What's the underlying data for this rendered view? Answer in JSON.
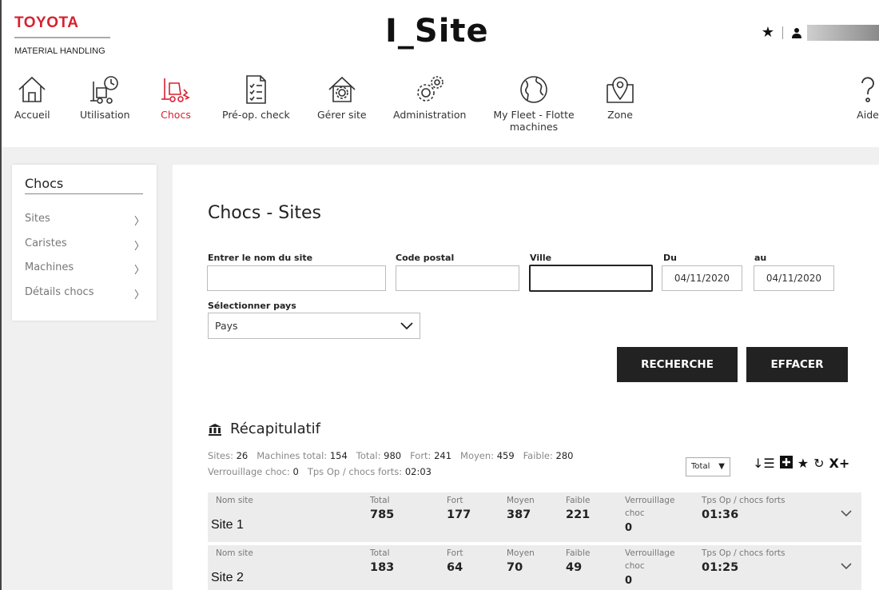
{
  "brand": {
    "name": "TOYOTA",
    "subtitle": "MATERIAL HANDLING"
  },
  "app_logo": "I_Site",
  "header_right": {
    "star_icon": "star-icon",
    "user_icon": "user-icon"
  },
  "nav": [
    {
      "label": "Accueil",
      "icon": "home-icon"
    },
    {
      "label": "Utilisation",
      "icon": "forklift-clock-icon"
    },
    {
      "label": "Chocs",
      "icon": "forklift-impact-icon",
      "active": true
    },
    {
      "label": "Pré-op. check",
      "icon": "checklist-icon"
    },
    {
      "label": "Gérer site",
      "icon": "gear-house-icon"
    },
    {
      "label": "Administration",
      "icon": "gears-icon"
    },
    {
      "label": "My Fleet - Flotte machines",
      "icon": "globe-icon"
    },
    {
      "label": "Zone",
      "icon": "map-pin-icon"
    },
    {
      "label": "Aide",
      "icon": "help-icon"
    }
  ],
  "sidebar": {
    "title": "Chocs",
    "items": [
      {
        "label": "Sites"
      },
      {
        "label": "Caristes"
      },
      {
        "label": "Machines"
      },
      {
        "label": "Détails chocs"
      }
    ]
  },
  "main": {
    "title": "Chocs - Sites",
    "fields": {
      "site_name_label": "Entrer le nom du site",
      "site_name_value": "",
      "postal_label": "Code postal",
      "postal_value": "",
      "city_label": "Ville",
      "city_value": "",
      "from_label": "Du",
      "from_value": "04/11/2020",
      "to_label": "au",
      "to_value": "04/11/2020",
      "country_label": "Sélectionner pays",
      "country_value": "Pays"
    },
    "buttons": {
      "search": "RECHERCHE",
      "clear": "EFFACER"
    },
    "summary": {
      "title": "Récapitulatif",
      "sites_label": "Sites:",
      "sites_value": "26",
      "machines_label": "Machines total:",
      "machines_value": "154",
      "total_label": "Total:",
      "total_value": "980",
      "fort_label": "Fort:",
      "fort_value": "241",
      "moyen_label": "Moyen:",
      "moyen_value": "459",
      "faible_label": "Faible:",
      "faible_value": "280",
      "lock_label": "Verrouillage choc:",
      "lock_value": "0",
      "tps_label": "Tps Op / chocs forts:",
      "tps_value": "02:03",
      "sort_value": "Total"
    },
    "columns": {
      "site": "Nom site",
      "total": "Total",
      "fort": "Fort",
      "moyen": "Moyen",
      "faible": "Faible",
      "lock_1": "Verrouillage",
      "lock_2": "choc",
      "tps": "Tps Op / chocs forts"
    },
    "rows": [
      {
        "site": "Site 1",
        "total": "785",
        "fort": "177",
        "moyen": "387",
        "faible": "221",
        "lock": "0",
        "tps": "01:36"
      },
      {
        "site": "Site 2",
        "total": "183",
        "fort": "64",
        "moyen": "70",
        "faible": "49",
        "lock": "0",
        "tps": "01:25"
      }
    ]
  },
  "colors": {
    "brand_red": "#d8202f",
    "button_dark": "#222222",
    "row_bg": "#ececec"
  }
}
